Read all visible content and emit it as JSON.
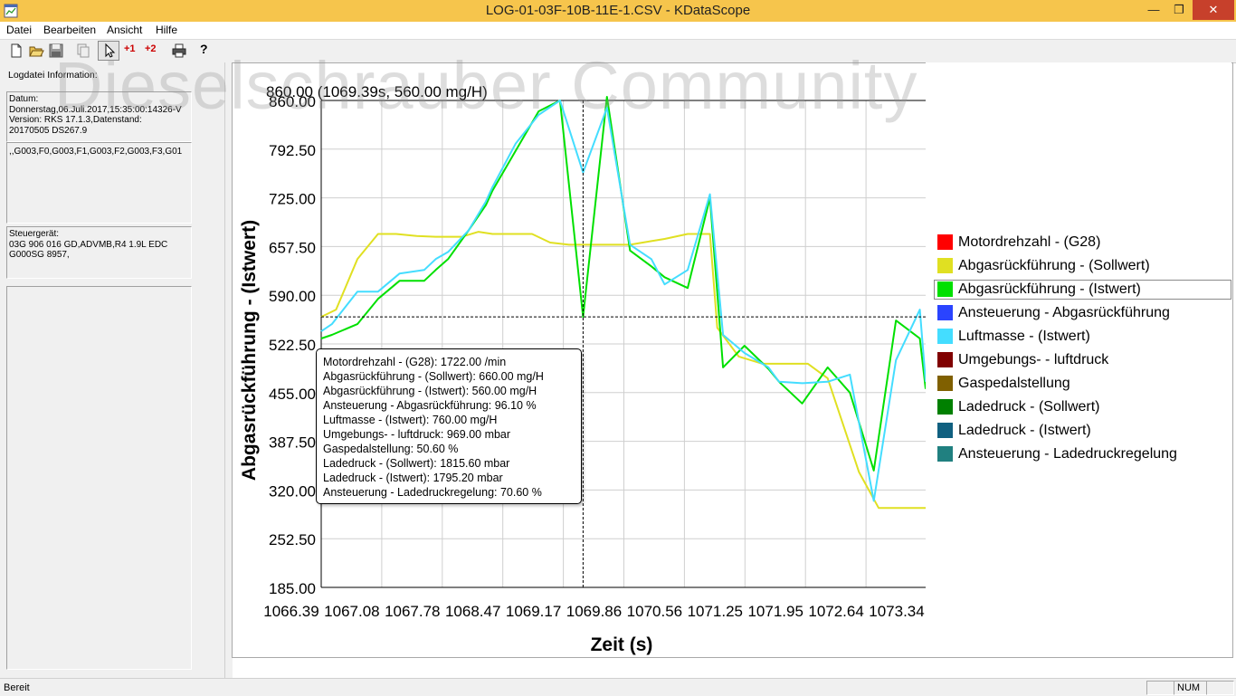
{
  "window": {
    "title": "LOG-01-03F-10B-11E-1.CSV - KDataScope",
    "min_glyph": "—",
    "max_glyph": "❐",
    "close_glyph": "✕"
  },
  "menu": [
    "Datei",
    "Bearbeiten",
    "Ansicht",
    "Hilfe"
  ],
  "toolbar": {
    "items": [
      "new-icon",
      "open-icon",
      "save-icon",
      "copy-icon",
      "cursor-icon",
      "cursor1-icon",
      "cursor2-icon",
      "print-icon",
      "help-icon"
    ],
    "cursor1_label": "+1",
    "cursor2_label": "+2",
    "help_glyph": "?",
    "cursor1_color": "#cc0000",
    "cursor2_color": "#cc0000"
  },
  "sidebar": {
    "heading": "Logdatei Information:",
    "datum": [
      "Datum:",
      "Donnerstag,06.Juli.2017,15:35:00:14326-V",
      "Version: RKS 17.1.3,Datenstand:",
      "20170505 DS267.9"
    ],
    "groups": ",,G003,F0,G003,F1,G003,F2,G003,F3,G01",
    "steuergeraet": [
      "Steuergerät:",
      "03G 906 016 GD,ADVMB,R4 1.9L EDC",
      "G000SG  8957,"
    ]
  },
  "watermark": "Dieselschrauber Community",
  "status": {
    "left": "Bereit",
    "num": "NUM"
  },
  "chart_data": {
    "type": "line",
    "header": "860.00 (1069.39s, 560.00 mg/H)",
    "xlabel": "Zeit (s)",
    "ylabel": "Abgasrückführung - (Istwert)",
    "xlim": [
      1066.39,
      1073.73
    ],
    "ylim": [
      185.0,
      860.0
    ],
    "x_ticks": [
      "1066.39",
      "1067.08",
      "1067.78",
      "1068.47",
      "1069.17",
      "1069.86",
      "1070.56",
      "1071.25",
      "1071.95",
      "1072.64",
      "1073.34"
    ],
    "y_ticks": [
      "860.00",
      "792.50",
      "725.00",
      "657.50",
      "590.00",
      "522.50",
      "455.00",
      "387.50",
      "320.00",
      "252.50",
      "185.00"
    ],
    "grid": true,
    "crosshair": {
      "x": 1069.57,
      "y": 560
    },
    "legend": [
      {
        "name": "Motordrehzahl - (G28)",
        "color": "#ff0000"
      },
      {
        "name": "Abgasrückführung - (Sollwert)",
        "color": "#e0e022"
      },
      {
        "name": "Abgasrückführung - (Istwert)",
        "color": "#00e000"
      },
      {
        "name": "Ansteuerung - Abgasrückführung",
        "color": "#2a44ff"
      },
      {
        "name": "Luftmasse - (Istwert)",
        "color": "#44ddff"
      },
      {
        "name": "Umgebungs- - luftdruck",
        "color": "#800000"
      },
      {
        "name": "Gaspedalstellung",
        "color": "#806000"
      },
      {
        "name": "Ladedruck - (Sollwert)",
        "color": "#008000"
      },
      {
        "name": "Ladedruck - (Istwert)",
        "color": "#106080"
      },
      {
        "name": "Ansteuerung - Ladedruckregelung",
        "color": "#208080"
      }
    ],
    "legend_selected": 2,
    "series": [
      {
        "name": "Abgasrückführung - (Sollwert)",
        "color": "#e0e022",
        "x": [
          1066.39,
          1066.57,
          1066.83,
          1067.08,
          1067.3,
          1067.55,
          1067.78,
          1068.1,
          1068.3,
          1068.47,
          1068.7,
          1068.95,
          1069.17,
          1069.4,
          1069.57,
          1069.86,
          1070.14,
          1070.4,
          1070.56,
          1070.84,
          1071.11,
          1071.2,
          1071.46,
          1071.75,
          1071.95,
          1072.3,
          1072.54,
          1072.92,
          1073.16,
          1073.73
        ],
        "y": [
          560,
          570,
          640,
          675,
          675,
          672,
          671,
          671,
          678,
          675,
          675,
          675,
          663,
          660,
          660,
          660,
          660,
          665,
          668,
          675,
          675,
          545,
          505,
          495,
          495,
          495,
          475,
          345,
          295,
          295
        ]
      },
      {
        "name": "Abgasrückführung - (Istwert)",
        "color": "#00e000",
        "x": [
          1066.39,
          1066.52,
          1066.83,
          1067.08,
          1067.34,
          1067.64,
          1067.78,
          1067.93,
          1068.18,
          1068.39,
          1068.47,
          1068.75,
          1069.03,
          1069.29,
          1069.57,
          1069.86,
          1070.14,
          1070.4,
          1070.56,
          1070.84,
          1071.11,
          1071.27,
          1071.53,
          1071.82,
          1071.95,
          1072.23,
          1072.54,
          1072.81,
          1073.1,
          1073.37,
          1073.66,
          1073.73
        ],
        "y": [
          530,
          535,
          550,
          585,
          610,
          610,
          625,
          640,
          680,
          715,
          735,
          790,
          845,
          860,
          560,
          865,
          652,
          630,
          615,
          600,
          725,
          490,
          520,
          488,
          470,
          440,
          490,
          455,
          347,
          555,
          530,
          460
        ]
      },
      {
        "name": "Luftmasse - (Istwert)",
        "color": "#44ddff",
        "x": [
          1066.39,
          1066.52,
          1066.83,
          1067.08,
          1067.34,
          1067.64,
          1067.78,
          1067.93,
          1068.18,
          1068.39,
          1068.47,
          1068.75,
          1069.03,
          1069.29,
          1069.57,
          1069.86,
          1070.14,
          1070.4,
          1070.56,
          1070.84,
          1071.11,
          1071.27,
          1071.53,
          1071.82,
          1071.95,
          1072.23,
          1072.54,
          1072.81,
          1073.1,
          1073.37,
          1073.66,
          1073.73
        ],
        "y": [
          540,
          550,
          595,
          595,
          620,
          625,
          640,
          650,
          680,
          720,
          740,
          800,
          840,
          860,
          760,
          850,
          660,
          640,
          605,
          625,
          730,
          535,
          510,
          490,
          470,
          468,
          470,
          480,
          305,
          500,
          570,
          470
        ]
      }
    ]
  },
  "tooltip": [
    "Motordrehzahl - (G28): 1722.00  /min",
    "Abgasrückführung - (Sollwert): 660.00  mg/H",
    "Abgasrückführung - (Istwert): 560.00  mg/H",
    "Ansteuerung - Abgasrückführung: 96.10  %",
    "Luftmasse - (Istwert): 760.00  mg/H",
    "Umgebungs- - luftdruck: 969.00  mbar",
    "Gaspedalstellung: 50.60  %",
    "Ladedruck - (Sollwert): 1815.60  mbar",
    "Ladedruck - (Istwert): 1795.20  mbar",
    "Ansteuerung - Ladedruckregelung: 70.60  %"
  ]
}
